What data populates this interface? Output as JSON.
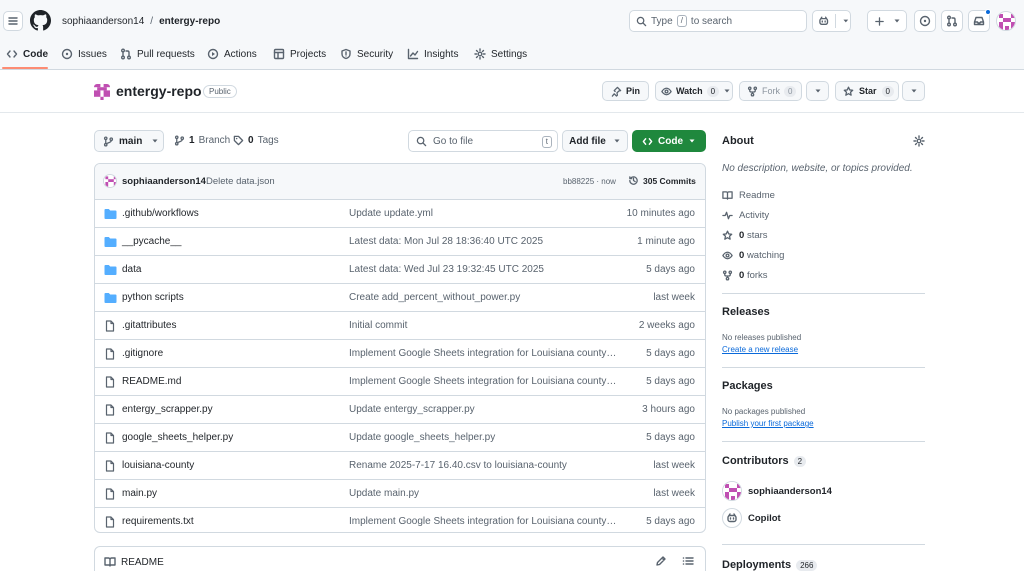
{
  "header": {
    "owner": "sophiaanderson14",
    "separator": "/",
    "repo": "entergy-repo",
    "search_prefix": "Type",
    "search_key": "/",
    "search_suffix": "to search"
  },
  "repo_nav": {
    "tabs": [
      {
        "label": "Code",
        "icon": "code-icon",
        "active": true
      },
      {
        "label": "Issues",
        "icon": "issue-icon"
      },
      {
        "label": "Pull requests",
        "icon": "pull-request-icon"
      },
      {
        "label": "Actions",
        "icon": "play-icon"
      },
      {
        "label": "Projects",
        "icon": "table-icon"
      },
      {
        "label": "Security",
        "icon": "shield-icon"
      },
      {
        "label": "Insights",
        "icon": "graph-icon"
      },
      {
        "label": "Settings",
        "icon": "gear-icon"
      }
    ]
  },
  "repo_title": {
    "name": "entergy-repo",
    "visibility": "Public",
    "pin_label": "Pin",
    "watch_label": "Watch",
    "watch_count": "0",
    "fork_label": "Fork",
    "fork_count": "0",
    "star_label": "Star",
    "star_count": "0"
  },
  "toolbar": {
    "branch": "main",
    "branch_count": "1",
    "branch_label": "Branch",
    "tag_count": "0",
    "tag_label": "Tags",
    "goto_placeholder": "Go to file",
    "goto_key": "t",
    "add_file_label": "Add file",
    "code_label": "Code"
  },
  "latest_commit": {
    "author": "sophiaanderson14",
    "message": "Delete data.json",
    "hash_time": "bb88225 · now",
    "commits_label": "305 Commits"
  },
  "files": [
    {
      "name": ".github/workflows",
      "type": "folder",
      "message": "Update update.yml",
      "time": "10 minutes ago"
    },
    {
      "name": "__pycache__",
      "type": "folder",
      "message": "Latest data: Mon Jul 28 18:36:40 UTC 2025",
      "time": "1 minute ago"
    },
    {
      "name": "data",
      "type": "folder",
      "message": "Latest data: Wed Jul 23 19:32:45 UTC 2025",
      "time": "5 days ago"
    },
    {
      "name": "python scripts",
      "type": "folder",
      "message": "Create add_percent_without_power.py",
      "time": "last week"
    },
    {
      "name": ".gitattributes",
      "type": "file",
      "message": "Initial commit",
      "time": "2 weeks ago"
    },
    {
      "name": ".gitignore",
      "type": "file",
      "message": "Implement Google Sheets integration for Louisiana county d...",
      "time": "5 days ago"
    },
    {
      "name": "README.md",
      "type": "file",
      "message": "Implement Google Sheets integration for Louisiana county d...",
      "time": "5 days ago"
    },
    {
      "name": "entergy_scrapper.py",
      "type": "file",
      "message": "Update entergy_scrapper.py",
      "time": "3 hours ago"
    },
    {
      "name": "google_sheets_helper.py",
      "type": "file",
      "message": "Update google_sheets_helper.py",
      "time": "5 days ago"
    },
    {
      "name": "louisiana-county",
      "type": "file",
      "message": "Rename 2025-7-17 16.40.csv to louisiana-county",
      "time": "last week"
    },
    {
      "name": "main.py",
      "type": "file",
      "message": "Update main.py",
      "time": "last week"
    },
    {
      "name": "requirements.txt",
      "type": "file",
      "message": "Implement Google Sheets integration for Louisiana county d...",
      "time": "5 days ago"
    }
  ],
  "readme": {
    "label": "README"
  },
  "about": {
    "title": "About",
    "description": "No description, website, or topics provided.",
    "readme": "Readme",
    "activity": "Activity",
    "stars_count": "0",
    "stars_label": "stars",
    "watching_count": "0",
    "watching_label": "watching",
    "forks_count": "0",
    "forks_label": "forks"
  },
  "releases": {
    "title": "Releases",
    "none": "No releases published",
    "link": "Create a new release"
  },
  "packages": {
    "title": "Packages",
    "none": "No packages published",
    "link": "Publish your first package"
  },
  "contributors": {
    "title": "Contributors",
    "count": "2",
    "people": [
      {
        "name": "sophiaanderson14"
      },
      {
        "name": "Copilot"
      }
    ]
  },
  "deployments": {
    "title": "Deployments",
    "count": "266"
  },
  "colors": {
    "accent_green": "#1f883d",
    "link_blue": "#0969da",
    "folder_blue": "#54aeff",
    "active_tab_underline": "#fd8c73",
    "avatar_pink": "#c04fb2",
    "notification_dot": "#0969da"
  }
}
